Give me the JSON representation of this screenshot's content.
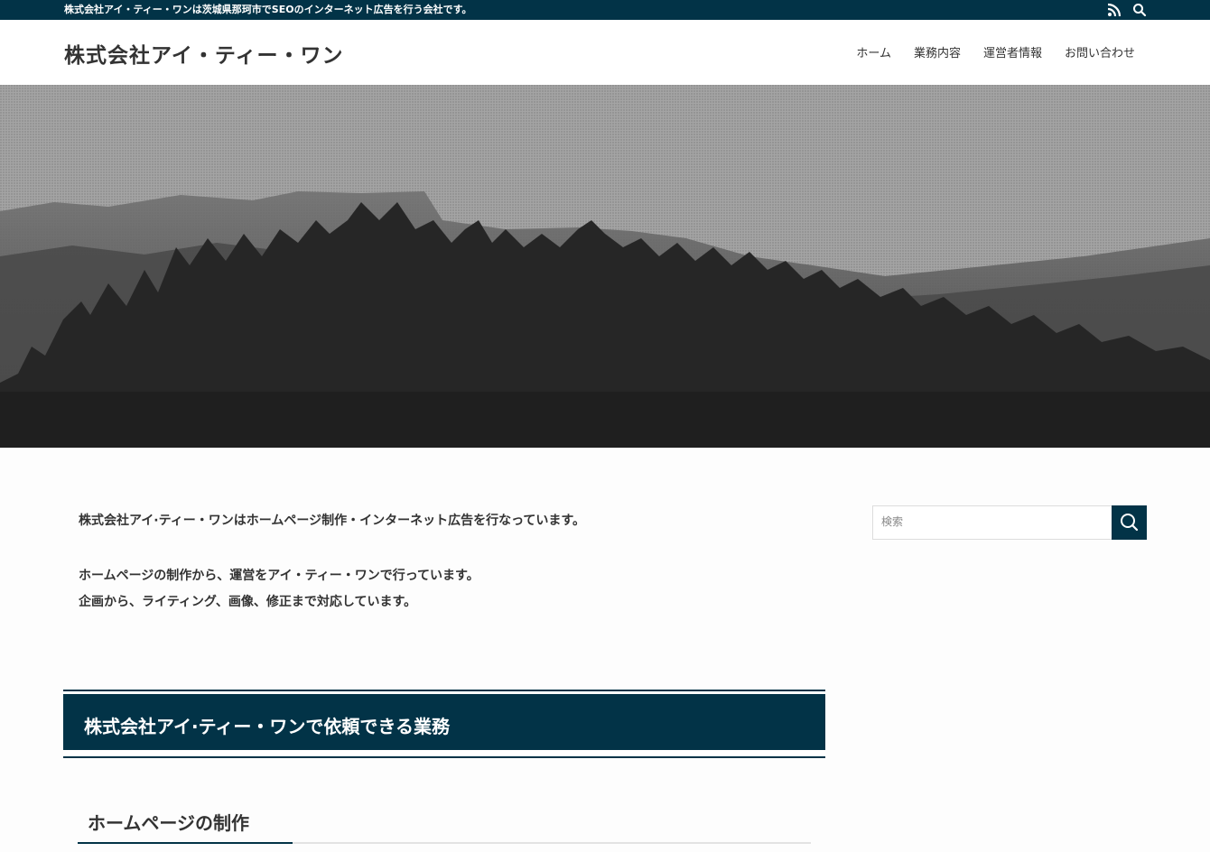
{
  "topbar": {
    "tagline": "株式会社アイ・ティー・ワンは茨城県那珂市でSEOのインターネット広告を行う会社です。",
    "icons": [
      "rss-icon",
      "search-icon"
    ]
  },
  "header": {
    "site_title": "株式会社アイ・ティー・ワン",
    "nav": [
      "ホーム",
      "業務内容",
      "運営者情報",
      "お問い合わせ"
    ]
  },
  "main": {
    "intro": [
      "株式会社アイ·ティー・ワンはホームページ制作・インターネット広告を行なっています。",
      "ホームページの制作から、運営をアイ・ティー・ワンで行っています。",
      "企画から、ライティング、画像、修正まで対応しています。"
    ],
    "section_title": "株式会社アイ·ティー・ワンで依頼できる業務",
    "sub_title": "ホームページの制作"
  },
  "sidebar": {
    "search_placeholder": "検索"
  },
  "colors": {
    "brand": "#023347",
    "text": "#333333"
  }
}
